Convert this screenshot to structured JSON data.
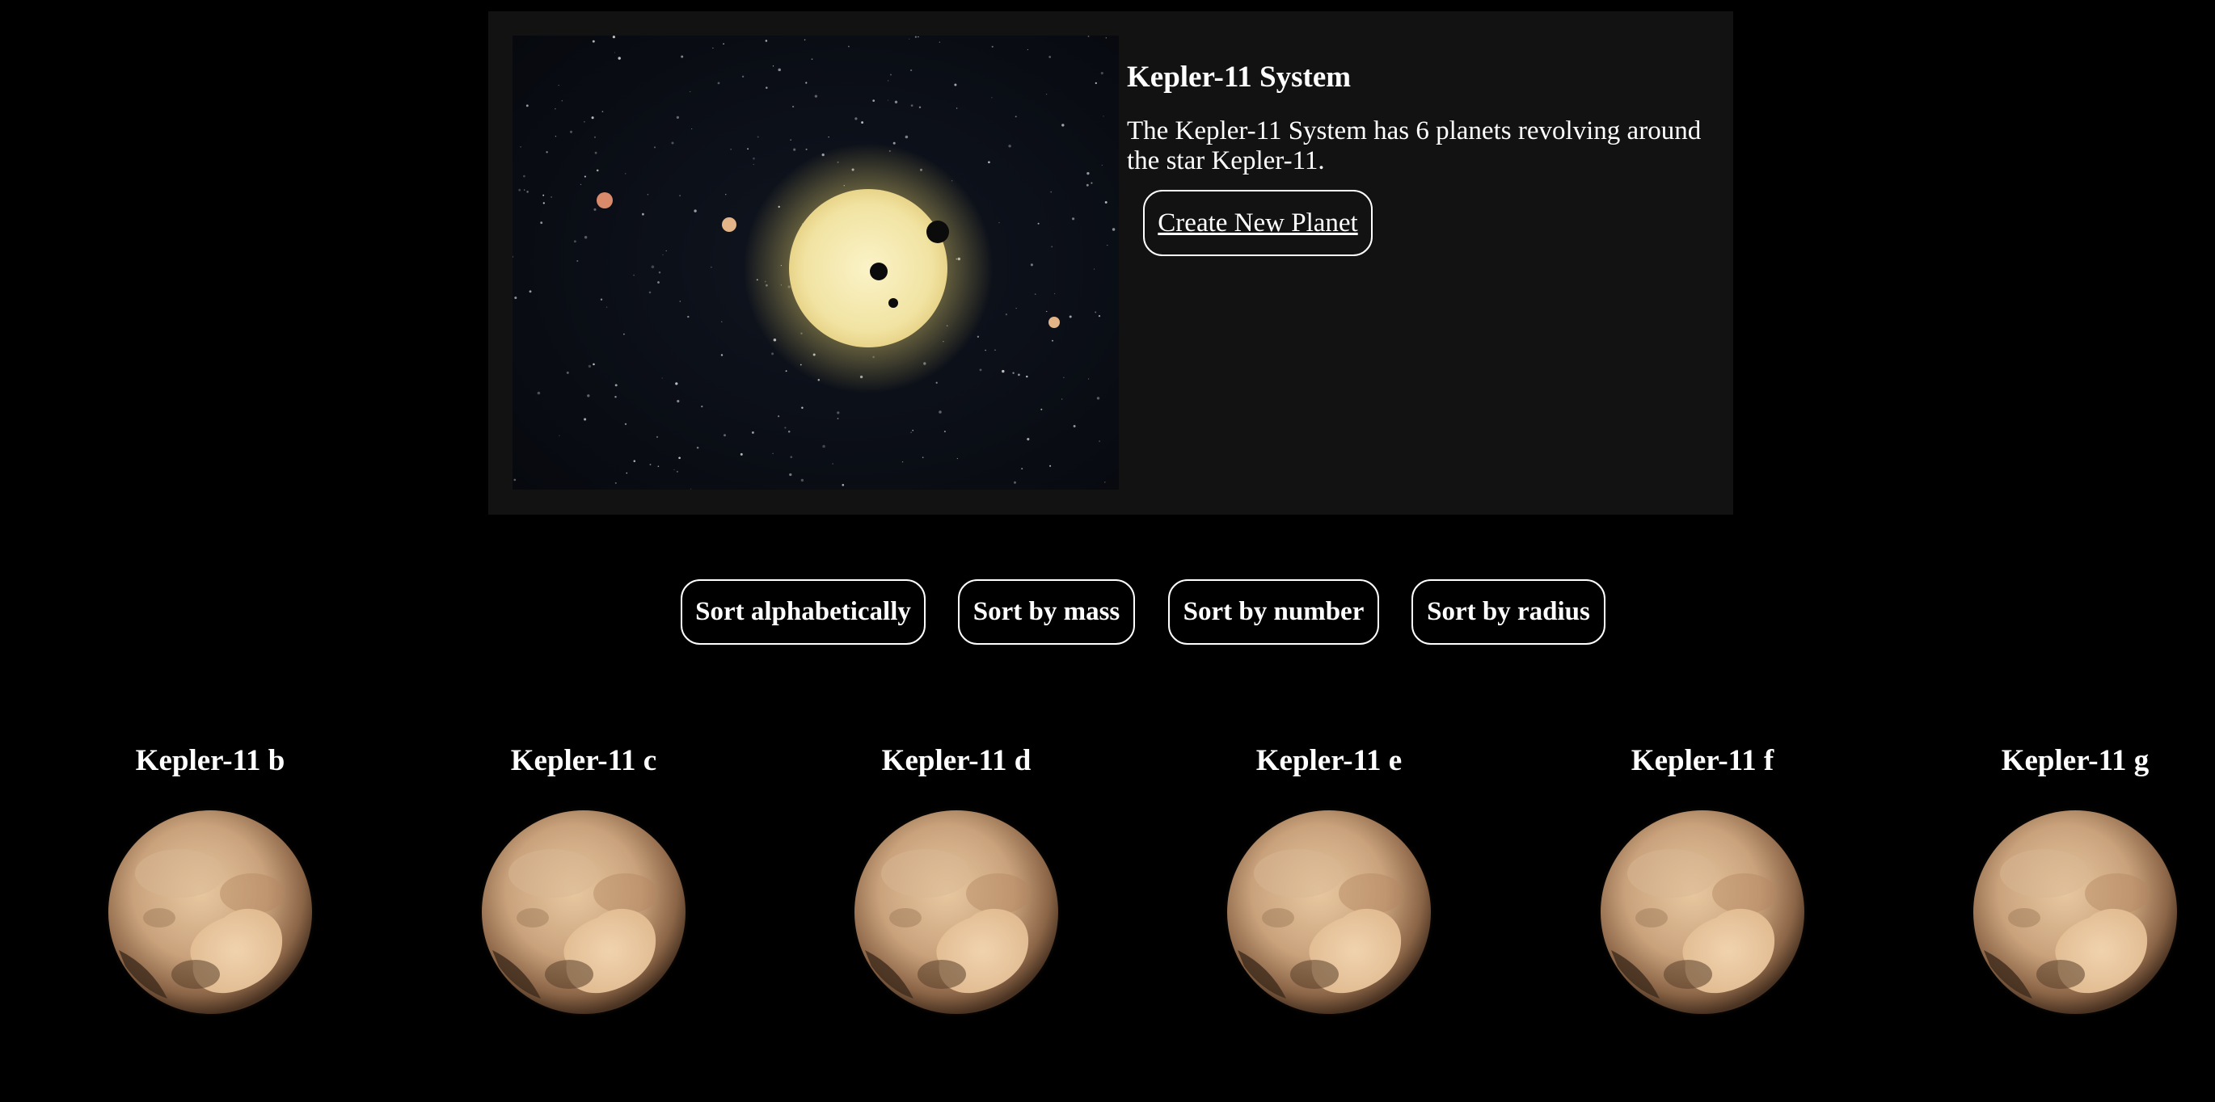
{
  "system": {
    "title": "Kepler-11 System",
    "description": "The Kepler-11 System has 6 planets revolving around the star Kepler-11.",
    "create_label": "Create New Planet"
  },
  "sort_buttons": [
    {
      "label": "Sort alphabetically"
    },
    {
      "label": "Sort by mass"
    },
    {
      "label": "Sort by number"
    },
    {
      "label": "Sort by radius"
    }
  ],
  "planets": [
    {
      "name": "Kepler-11 b"
    },
    {
      "name": "Kepler-11 c"
    },
    {
      "name": "Kepler-11 d"
    },
    {
      "name": "Kepler-11 e"
    },
    {
      "name": "Kepler-11 f"
    },
    {
      "name": "Kepler-11 g"
    }
  ],
  "colors": {
    "page_background": "#000000",
    "card_background": "#121212",
    "text": "#ffffff",
    "star": "#f3e6a8",
    "planet_surface": "#c9a27c"
  }
}
